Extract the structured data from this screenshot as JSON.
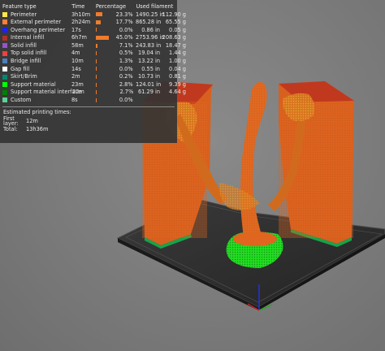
{
  "legend": {
    "headers": {
      "feature": "Feature type",
      "time": "Time",
      "percentage": "Percentage",
      "filament": "Used filament"
    },
    "rows": [
      {
        "name": "Perimeter",
        "time": "3h10m",
        "pct": "23.3%",
        "pct_value": 23.3,
        "length": "1490.25 in",
        "weight": "112.90 g",
        "color": "#FFE64D"
      },
      {
        "name": "External perimeter",
        "time": "2h24m",
        "pct": "17.7%",
        "pct_value": 17.7,
        "length": "865.28 in",
        "weight": "65.55 g",
        "color": "#FF7D38"
      },
      {
        "name": "Overhang perimeter",
        "time": "17s",
        "pct": "0.0%",
        "pct_value": 0.0,
        "length": "0.86 in",
        "weight": "0.05 g",
        "color": "#1F1FFF"
      },
      {
        "name": "Internal infill",
        "time": "6h7m",
        "pct": "45.0%",
        "pct_value": 45.0,
        "length": "2753.96 in",
        "weight": "208.63 g",
        "color": "#B03029"
      },
      {
        "name": "Solid infill",
        "time": "58m",
        "pct": "7.1%",
        "pct_value": 7.1,
        "length": "243.83 in",
        "weight": "18.47 g",
        "color": "#9654CC"
      },
      {
        "name": "Top solid infill",
        "time": "4m",
        "pct": "0.5%",
        "pct_value": 0.5,
        "length": "19.04 in",
        "weight": "1.44 g",
        "color": "#F04040"
      },
      {
        "name": "Bridge infill",
        "time": "10m",
        "pct": "1.3%",
        "pct_value": 1.3,
        "length": "13.22 in",
        "weight": "1.00 g",
        "color": "#4D80BA"
      },
      {
        "name": "Gap fill",
        "time": "14s",
        "pct": "0.0%",
        "pct_value": 0.0,
        "length": "0.55 in",
        "weight": "0.04 g",
        "color": "#FFFFFF"
      },
      {
        "name": "Skirt/Brim",
        "time": "2m",
        "pct": "0.2%",
        "pct_value": 0.2,
        "length": "10.73 in",
        "weight": "0.81 g",
        "color": "#00876E"
      },
      {
        "name": "Support material",
        "time": "23m",
        "pct": "2.8%",
        "pct_value": 2.8,
        "length": "124.01 in",
        "weight": "9.39 g",
        "color": "#00FF00"
      },
      {
        "name": "Support material interface",
        "time": "22m",
        "pct": "2.7%",
        "pct_value": 2.7,
        "length": "61.29 in",
        "weight": "4.64 g",
        "color": "#008000"
      },
      {
        "name": "Custom",
        "time": "8s",
        "pct": "0.0%",
        "pct_value": 0.0,
        "length": "",
        "weight": "",
        "color": "#5ED194"
      }
    ],
    "estimated": {
      "title": "Estimated printing times:",
      "first_layer_label": "First layer:",
      "first_layer_value": "12m",
      "total_label": "Total:",
      "total_value": "13h36m"
    }
  },
  "colors": {
    "bar": "#F07B2C",
    "model_orange": "#E26A22",
    "support_green": "#22DD22",
    "bed": "#2B2B2B"
  }
}
